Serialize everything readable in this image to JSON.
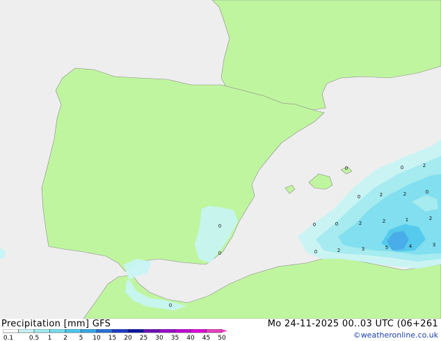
{
  "title": "Precipitation [mm]",
  "model": "GFS",
  "datetime": "Mo 24-11-2025 00..03 UTC (06+261",
  "credit": "©weatheronline.co.uk",
  "legend": {
    "labels": [
      "0.1",
      "0.5",
      "1",
      "2",
      "5",
      "10",
      "15",
      "20",
      "25",
      "30",
      "35",
      "40",
      "45",
      "50"
    ],
    "colors": [
      "#ffffff",
      "#c8f5f5",
      "#a0ebf0",
      "#78def0",
      "#4ac8ec",
      "#3aa8e8",
      "#2a70d8",
      "#1c3cc8",
      "#0c14a0",
      "#6e10b8",
      "#9a0ccc",
      "#c008d6",
      "#e008d8",
      "#e840c0"
    ]
  },
  "colors": {
    "land": "#c0f5a0",
    "sea": "#eeeeee",
    "border": "#888888"
  },
  "map_values": [
    {
      "id": "v1",
      "text": "0"
    },
    {
      "id": "v2",
      "text": "2"
    },
    {
      "id": "v3",
      "text": "0"
    },
    {
      "id": "v4",
      "text": "2"
    },
    {
      "id": "v5",
      "text": "2"
    },
    {
      "id": "v6",
      "text": "0"
    },
    {
      "id": "v7",
      "text": "0"
    },
    {
      "id": "v8",
      "text": "0"
    },
    {
      "id": "v9",
      "text": "2"
    },
    {
      "id": "v10",
      "text": "2"
    },
    {
      "id": "v11",
      "text": "1"
    },
    {
      "id": "v12",
      "text": "2"
    },
    {
      "id": "v13",
      "text": "0"
    },
    {
      "id": "v14",
      "text": "2"
    },
    {
      "id": "v15",
      "text": "3"
    },
    {
      "id": "v16",
      "text": "5"
    },
    {
      "id": "v17",
      "text": "4"
    },
    {
      "id": "v18",
      "text": "3"
    },
    {
      "id": "v19",
      "text": "0"
    },
    {
      "id": "v20",
      "text": "0"
    },
    {
      "id": "v21",
      "text": "0"
    },
    {
      "id": "v22",
      "text": "0"
    }
  ]
}
